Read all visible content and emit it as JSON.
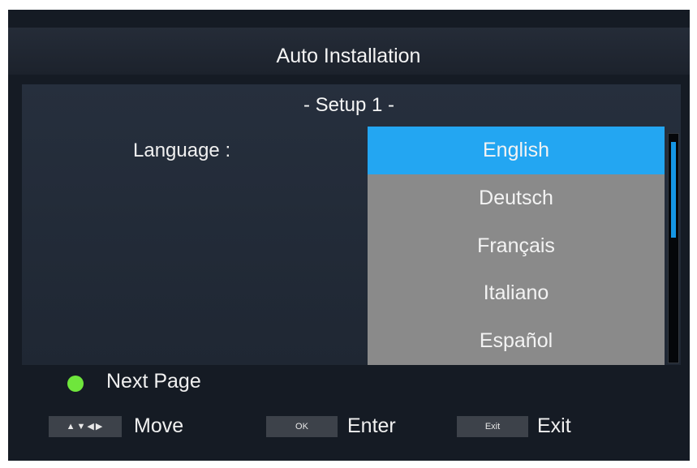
{
  "header": {
    "title": "Auto Installation"
  },
  "setup": {
    "step": "- Setup 1 -"
  },
  "form": {
    "language_label": "Language :"
  },
  "language_list": {
    "selected": "English",
    "items": [
      "English",
      "Deutsch",
      "Français",
      "Italiano",
      "Español"
    ]
  },
  "footer": {
    "next_page": "Next Page",
    "move_key": "▲▼◀▶",
    "move_label": "Move",
    "ok_key": "OK",
    "enter_label": "Enter",
    "exit_key": "Exit",
    "exit_label": "Exit"
  },
  "colors": {
    "highlight": "#23a6f2",
    "list_bg": "#8a8a8a",
    "green_button": "#6fe63c"
  },
  "icons": {
    "green_button": "green-dot-icon",
    "scrollbar": "scrollbar"
  }
}
